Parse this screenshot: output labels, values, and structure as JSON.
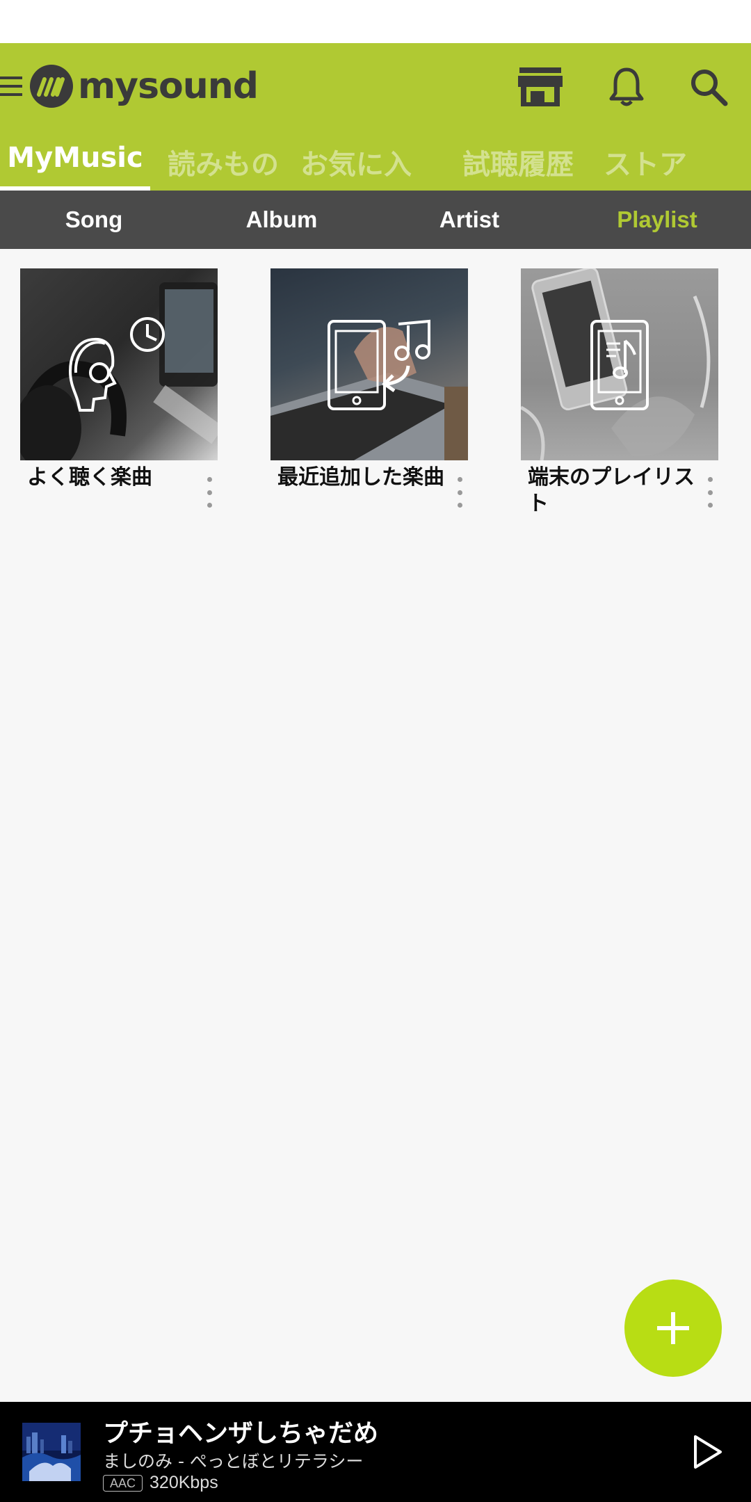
{
  "app": {
    "name": "mysound",
    "brand_color": "#b0c933",
    "fab_color": "#b8dd14"
  },
  "header": {
    "icons": [
      "menu-icon",
      "store-icon",
      "bell-icon",
      "search-icon"
    ]
  },
  "main_tabs": [
    {
      "label": "MyMusic",
      "active": true
    },
    {
      "label": "読みもの",
      "active": false
    },
    {
      "label": "お気に入り",
      "active": false
    },
    {
      "label": "試聴履歴",
      "active": false
    },
    {
      "label": "ストア",
      "active": false
    }
  ],
  "sub_tabs": [
    {
      "label": "Song",
      "active": false
    },
    {
      "label": "Album",
      "active": false
    },
    {
      "label": "Artist",
      "active": false
    },
    {
      "label": "Playlist",
      "active": true
    }
  ],
  "playlists": [
    {
      "title": "よく聴く楽曲",
      "icon": "headphones-clock-icon"
    },
    {
      "title": "最近追加した楽曲",
      "icon": "phone-music-add-icon"
    },
    {
      "title": "端末のプレイリスト",
      "icon": "phone-playlist-icon"
    }
  ],
  "fab": {
    "icon": "plus-icon"
  },
  "now_playing": {
    "title": "プチョヘンザしちゃだめ",
    "artist": "ましのみ - ぺっとぼとリテラシー",
    "codec": "AAC",
    "bitrate": "320Kbps",
    "icon": "play-icon"
  }
}
